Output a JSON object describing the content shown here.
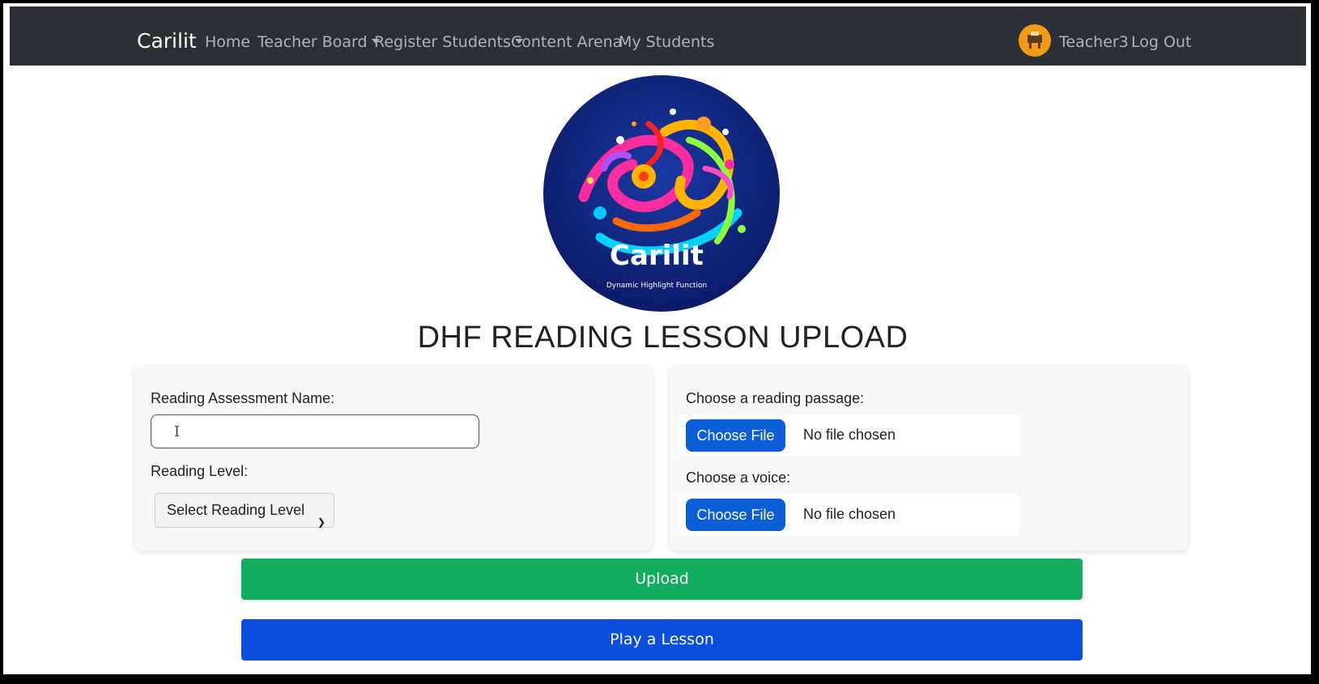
{
  "navbar": {
    "brand": "Carilit",
    "items": [
      {
        "label": "Home"
      },
      {
        "label": "Teacher Board"
      },
      {
        "label": "Register Students"
      },
      {
        "label": "Content Arena"
      },
      {
        "label": "My Students"
      }
    ],
    "user": {
      "name": "Teacher3",
      "avatar_color": "#f39a12"
    },
    "logout_label": "Log Out"
  },
  "logo": {
    "name": "Carilit",
    "tagline": "Dynamic Highlight Function"
  },
  "page_title": "DHF READING LESSON UPLOAD",
  "form": {
    "assessment_name_label": "Reading Assessment Name:",
    "assessment_name_value": "",
    "reading_level_label": "Reading Level:",
    "reading_level_selected": "Select Reading Level",
    "passage_label": "Choose a reading passage:",
    "passage_button": "Choose File",
    "passage_status": "No file chosen",
    "voice_label": "Choose a voice:",
    "voice_button": "Choose File",
    "voice_status": "No file chosen"
  },
  "actions": {
    "upload_label": "Upload",
    "play_label": "Play a Lesson"
  },
  "colors": {
    "navbar": "#2b3036",
    "upload": "#13ad5f",
    "play": "#0a4fdc",
    "file_button": "#0b5ed7"
  }
}
